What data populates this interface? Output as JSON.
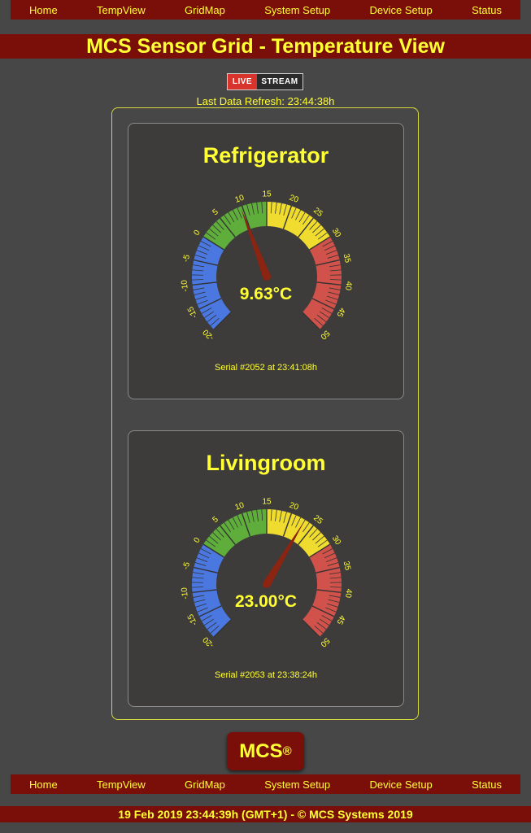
{
  "nav": {
    "items": [
      {
        "label": "Home"
      },
      {
        "label": "TempView"
      },
      {
        "label": "GridMap"
      },
      {
        "label": "System Setup"
      },
      {
        "label": "Device Setup"
      },
      {
        "label": "Status"
      }
    ]
  },
  "page": {
    "title": "MCS Sensor Grid - Temperature View",
    "live_label": "LIVE",
    "stream_label": "STREAM",
    "refresh_text": "Last Data Refresh: 23:44:38h"
  },
  "gauge_scale": {
    "min": -20,
    "max": 50,
    "ticks": [
      "-20",
      "-15",
      "-10",
      "-5",
      "0",
      "5",
      "10",
      "15",
      "20",
      "25",
      "30",
      "35",
      "40",
      "45",
      "50"
    ],
    "zones": [
      {
        "from": -20,
        "to": 0,
        "color": "#4a78e0"
      },
      {
        "from": 0,
        "to": 15,
        "color": "#5fae3b"
      },
      {
        "from": 15,
        "to": 30,
        "color": "#efdc2e"
      },
      {
        "from": 30,
        "to": 50,
        "color": "#d0524a"
      }
    ],
    "needle_color": "#8b2410"
  },
  "sensors": [
    {
      "name": "Refrigerator",
      "value": 9.63,
      "reading": "9.63°C",
      "serial": "Serial #2052 at 23:41:08h"
    },
    {
      "name": "Livingroom",
      "value": 23.0,
      "reading": "23.00°C",
      "serial": "Serial #2053 at 23:38:24h"
    }
  ],
  "logo": {
    "text": "MCS",
    "mark": "®"
  },
  "footer": {
    "text": "19 Feb 2019 23:44:39h (GMT+1) - © MCS Systems 2019"
  }
}
